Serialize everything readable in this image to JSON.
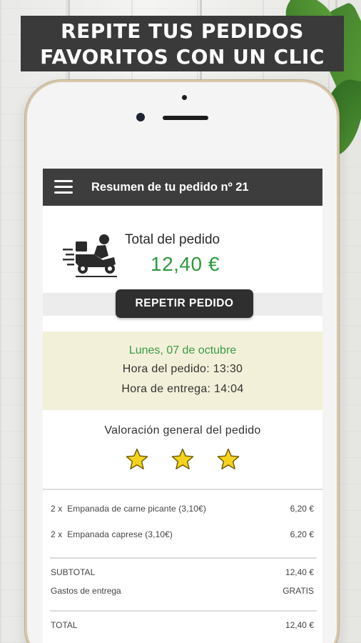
{
  "banner": {
    "line1": "REPITE TUS PEDIDOS",
    "line2": "FAVORITOS CON UN CLIC"
  },
  "colors": {
    "appbar": "#3d3d3d",
    "total_amount": "#2c9a3c",
    "date_box_bg": "#f3f0d9",
    "star": "#f5d21c"
  },
  "appbar": {
    "menu_icon": "hamburger-menu-icon",
    "title": "Resumen de tu pedido nº 21"
  },
  "order_total": {
    "icon": "delivery-scooter-icon",
    "label": "Total del pedido",
    "amount": "12,40 €"
  },
  "repeat_button": {
    "label": "REPETIR PEDIDO"
  },
  "order_info": {
    "date": "Lunes, 07 de octubre",
    "order_time": "Hora del pedido: 13:30",
    "delivery_time": "Hora de entrega: 14:04"
  },
  "rating": {
    "title": "Valoración general del pedido",
    "stars_filled": 3,
    "stars_shown": 3
  },
  "items": [
    {
      "qty": "2 x",
      "name": "Empanada de carne picante (3,10€)",
      "price": "6,20 €"
    },
    {
      "qty": "2 x",
      "name": "Empanada caprese (3,10€)",
      "price": "6,20 €"
    }
  ],
  "summary": {
    "subtotal_label": "SUBTOTAL",
    "subtotal_value": "12,40 €",
    "delivery_label": "Gastos de entrega",
    "delivery_value": "GRATIS",
    "total_label": "TOTAL",
    "total_value": "12,40 €"
  }
}
